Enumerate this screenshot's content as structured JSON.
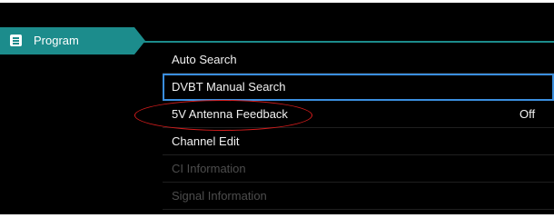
{
  "sidebar": {
    "tab_label": "Program",
    "tab_icon": "list-icon"
  },
  "menu": {
    "items": [
      {
        "label": "Auto Search",
        "value": "",
        "state": "normal"
      },
      {
        "label": "DVBT Manual Search",
        "value": "",
        "state": "selected"
      },
      {
        "label": "5V Antenna Feedback",
        "value": "Off",
        "state": "normal"
      },
      {
        "label": "Channel Edit",
        "value": "",
        "state": "normal"
      },
      {
        "label": "CI Information",
        "value": "",
        "state": "disabled"
      },
      {
        "label": "Signal Information",
        "value": "",
        "state": "disabled"
      }
    ]
  },
  "colors": {
    "accent_teal": "#1c8c8c",
    "selection_blue": "#3a8ede",
    "annotation_red": "#d41c1c"
  }
}
